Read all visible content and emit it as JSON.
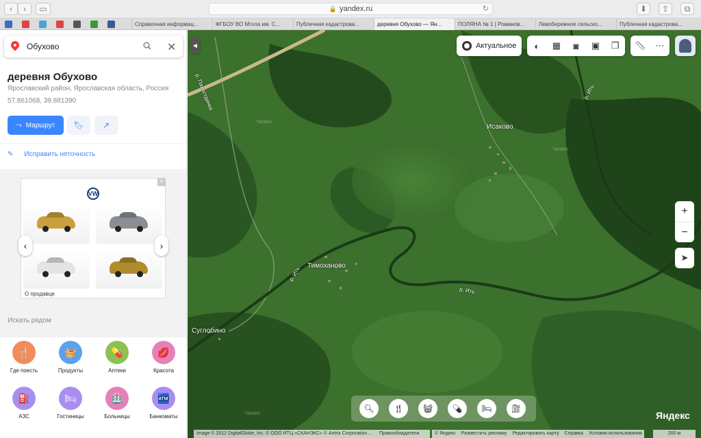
{
  "browser": {
    "url": "yandex.ru",
    "tabs": [
      "Справочная информац...",
      "ФГБОУ ВО Мгхла им. С...",
      "Публичная кадастрова...",
      "деревня Обухово — Ян...",
      "ПОЛЯНА № 1 | Романов...",
      "Левобережное сельско...",
      "Публичная кадастрова..."
    ],
    "active_tab": 3,
    "favorites_colors": [
      "#3b6ec5",
      "#d44",
      "#4aa0d8",
      "#d44",
      "#555",
      "#3a9a3a",
      "#3b5998"
    ]
  },
  "search": {
    "value": "Обухово"
  },
  "place": {
    "title": "деревня Обухово",
    "region": "Ярославский район, Ярославская область, Россия",
    "coords": "57.861068, 39.881390",
    "route_label": "Маршрут",
    "edit_label": "Исправить неточность"
  },
  "ad": {
    "brand_icon": "volkswagen-logo",
    "car_colors": [
      "#c9a13a",
      "#8a8d92",
      "#e4e4e4",
      "#b28c2c"
    ],
    "seller_label": "О продавце",
    "close_label": "×"
  },
  "nearby": {
    "header": "Искать рядом",
    "categories": [
      {
        "label": "Где поесть",
        "color": "#f08d5a",
        "icon": "fork-knife-icon",
        "glyph": "🍴"
      },
      {
        "label": "Продукты",
        "color": "#5aa1f0",
        "icon": "basket-icon",
        "glyph": "🧺"
      },
      {
        "label": "Аптеки",
        "color": "#8cc152",
        "icon": "pill-icon",
        "glyph": "💊"
      },
      {
        "label": "Красота",
        "color": "#e77fb8",
        "icon": "lips-icon",
        "glyph": "💋"
      },
      {
        "label": "АЗС",
        "color": "#a98ef0",
        "icon": "fuel-icon",
        "glyph": "⛽"
      },
      {
        "label": "Гостиницы",
        "color": "#a98ef0",
        "icon": "bed-icon",
        "glyph": "🛏"
      },
      {
        "label": "Больницы",
        "color": "#e77fb8",
        "icon": "hospital-icon",
        "glyph": "🏥"
      },
      {
        "label": "Банкоматы",
        "color": "#a98ef0",
        "icon": "atm-icon",
        "glyph": "🏧"
      }
    ]
  },
  "map": {
    "actual_label": "Актуальное",
    "places": [
      "Исаково",
      "Тимоханово",
      "Суглобино"
    ],
    "rivers": [
      "р. Ить",
      "р. Ить",
      "р. Ить",
      "р. Пахостдинка"
    ],
    "watermark": "Yandex",
    "zoom_in": "+",
    "zoom_out": "−",
    "copyright_left": "Image © 2012 DigitalGlobe, Inc. © ООО ИТЦ «СКАНЭКС» © Antrix Corporation ...",
    "copyright_right_owner": "Правообладатели",
    "copyright_links": [
      "© Яндекс",
      "Разместить рекламу",
      "Редактировать карту",
      "Справка",
      "Условия использования"
    ],
    "scale": "200 м",
    "logo": "Яндекс"
  }
}
